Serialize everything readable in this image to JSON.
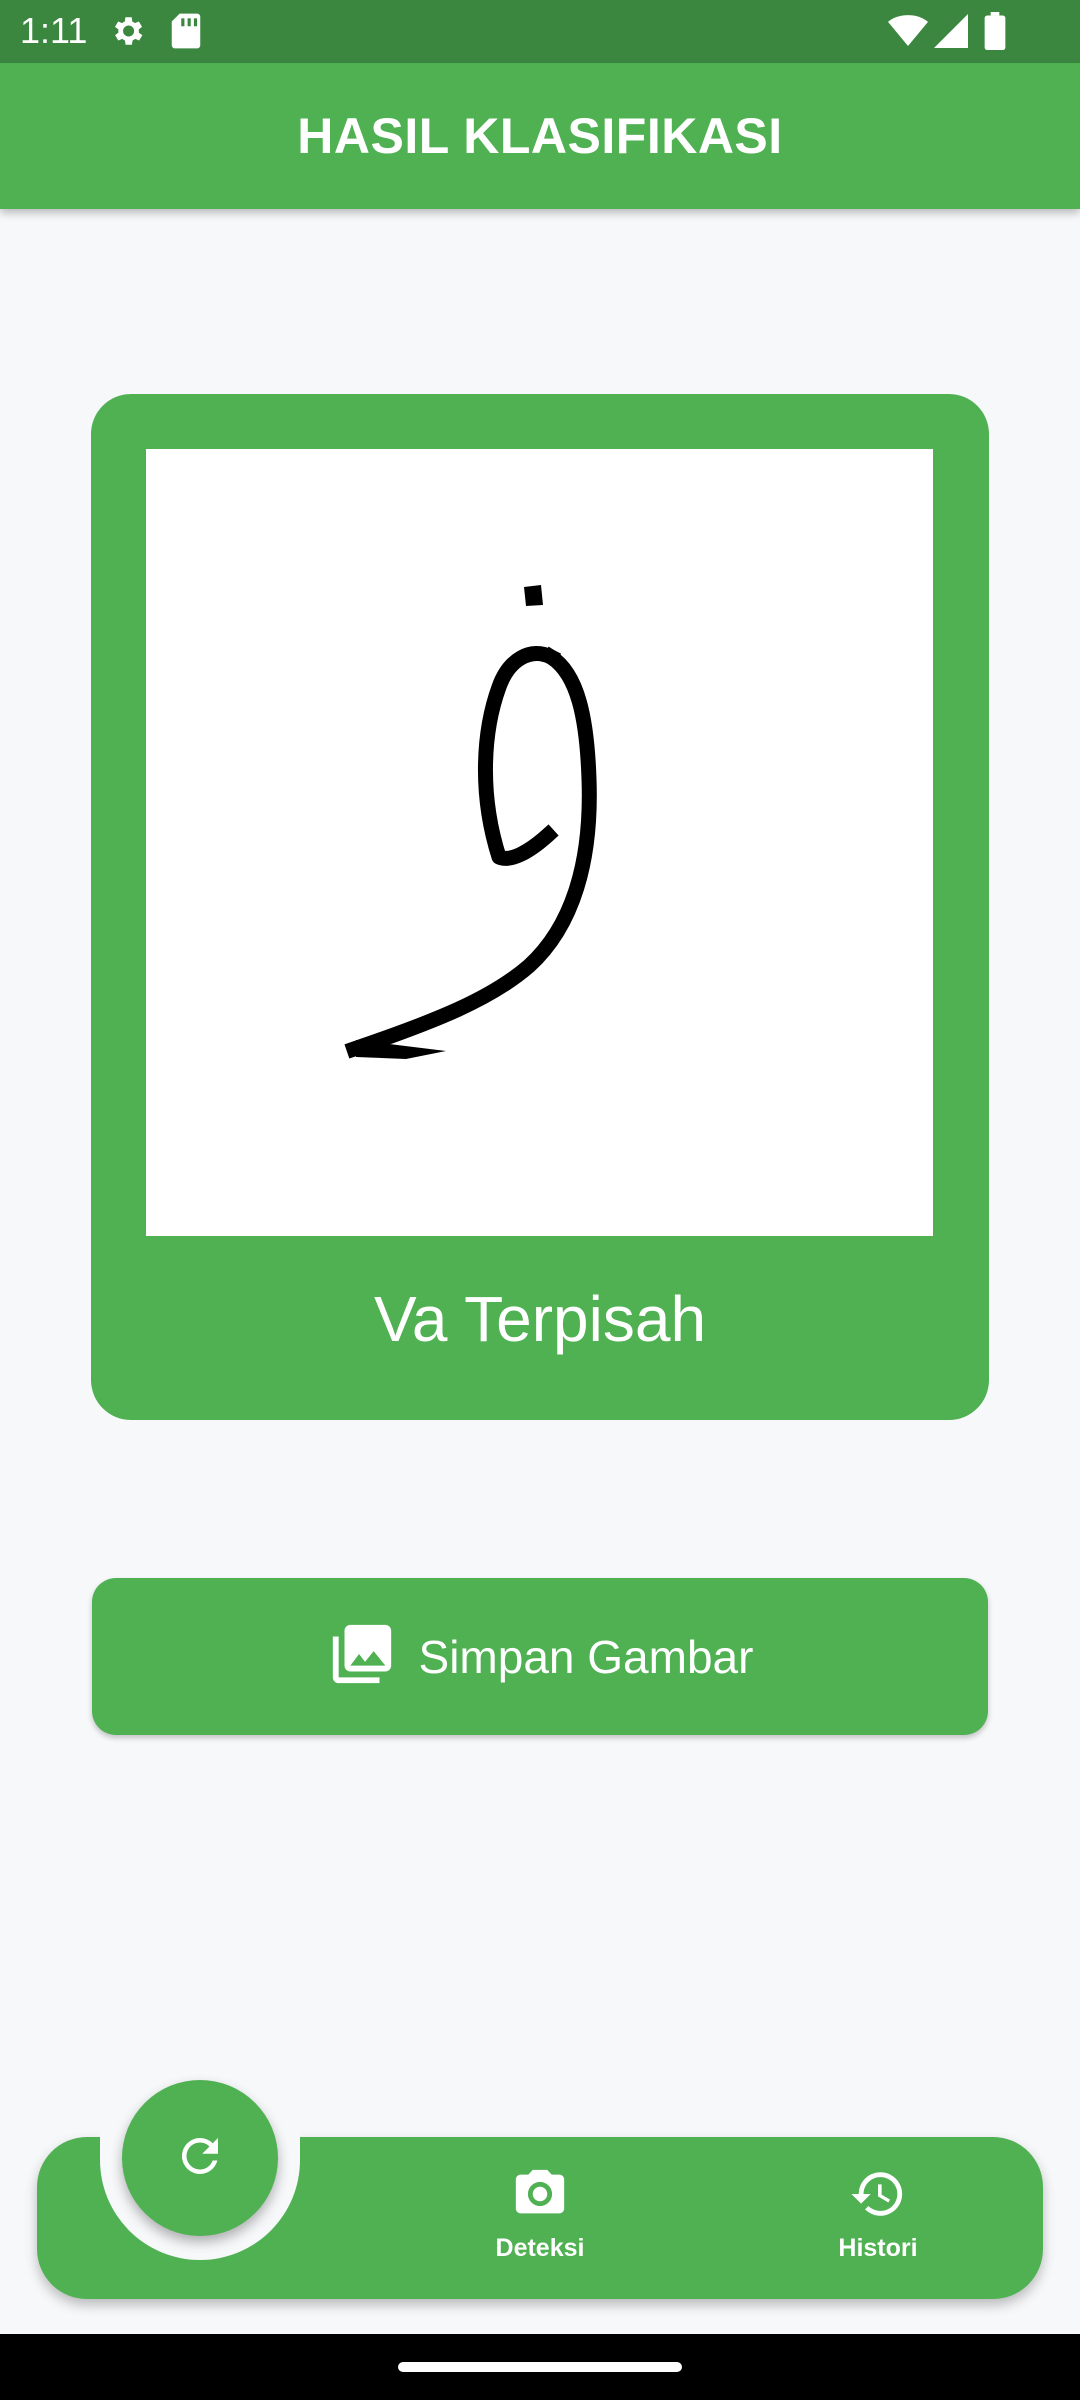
{
  "status_bar": {
    "time": "1:11",
    "icons": [
      "settings-icon",
      "sd-card-icon",
      "wifi-icon",
      "signal-icon",
      "battery-icon"
    ]
  },
  "app_bar": {
    "title": "HASIL KLASIFIKASI"
  },
  "result": {
    "image_icon": "handwritten-character-image",
    "label": "Va Terpisah"
  },
  "actions": {
    "save_label": "Simpan Gambar",
    "save_icon": "photo-library-icon"
  },
  "bottom_nav": {
    "fab_icon": "refresh-icon",
    "items": [
      {
        "label": "Deteksi",
        "icon": "camera-icon"
      },
      {
        "label": "Histori",
        "icon": "history-icon"
      }
    ]
  },
  "colors": {
    "primary": "#4FB152",
    "status_bar": "#3B8740",
    "background": "#F7F8FA"
  }
}
